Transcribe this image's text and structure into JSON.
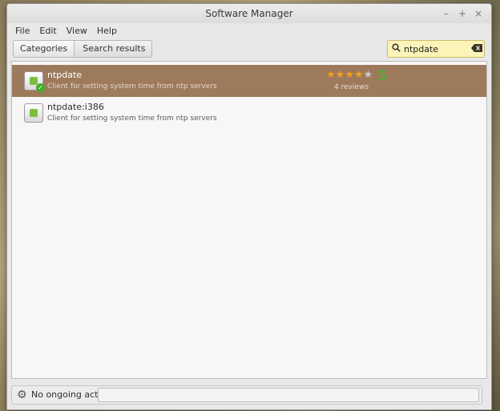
{
  "window": {
    "title": "Software Manager",
    "controls": {
      "minimize": "–",
      "maximize": "+",
      "close": "×"
    }
  },
  "menu": [
    "File",
    "Edit",
    "View",
    "Help"
  ],
  "breadcrumb": {
    "categories": "Categories",
    "current": "Search results"
  },
  "search": {
    "value": "ntpdate",
    "icon": "search-icon",
    "clear_icon": "clear-icon"
  },
  "results": [
    {
      "name": "ntpdate",
      "description": "Client for setting system time from ntp servers",
      "installed": true,
      "selected": true,
      "rating": {
        "stars": 4,
        "max": 5,
        "score": "5",
        "reviews": "4 reviews"
      }
    },
    {
      "name": "ntpdate:i386",
      "description": "Client for setting system time from ntp servers",
      "installed": false,
      "selected": false
    }
  ],
  "status": {
    "text": "No ongoing actions",
    "icon": "gear-icon"
  },
  "colors": {
    "selection": "#9e7a5c",
    "search_bg": "#fbf3b8",
    "star": "#f0a020",
    "score": "#5ca83a"
  }
}
